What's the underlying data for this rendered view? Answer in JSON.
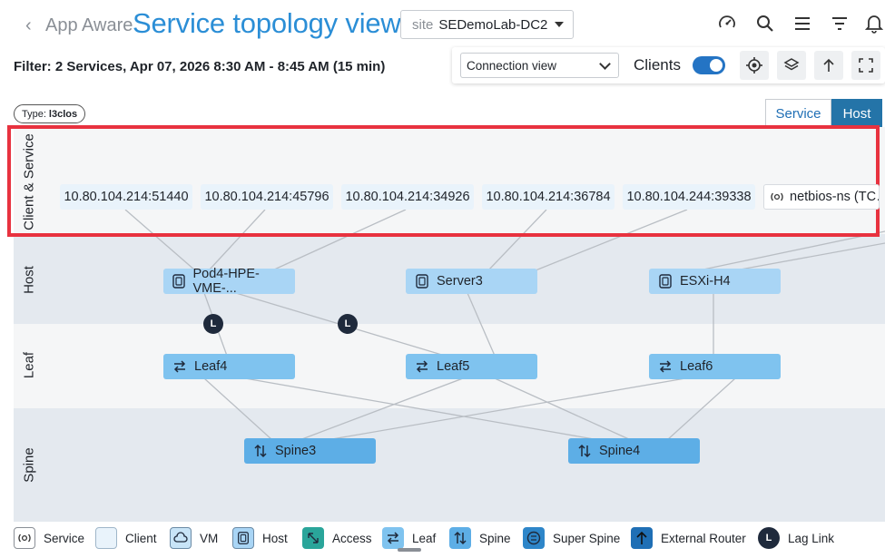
{
  "header": {
    "back_icon": "chevron-left-icon",
    "app_name": "App Aware",
    "title": "Service topology view",
    "site_label": "site",
    "site_value": "SEDemoLab-DC2",
    "icons": [
      "speedometer-icon",
      "search-icon",
      "menu-icon",
      "filter-icon",
      "bell-icon"
    ]
  },
  "filter_text": "Filter: 2 Services, Apr 07, 2026 8:30 AM - 8:45 AM (15 min)",
  "toolbar": {
    "view_select": "Connection view",
    "clients_label": "Clients",
    "clients_on": true,
    "buttons": [
      "locate-icon",
      "layers-icon",
      "arrow-up-icon",
      "fullscreen-icon"
    ]
  },
  "type_badge": {
    "label": "Type:",
    "value": "l3clos"
  },
  "segment": {
    "service": "Service",
    "host": "Host",
    "active": "Host"
  },
  "bands": {
    "client": "Client & Service",
    "host": "Host",
    "leaf": "Leaf",
    "spine": "Spine"
  },
  "nodes": {
    "clients": [
      "10.80.104.214:51440",
      "10.80.104.214:45796",
      "10.80.104.214:34926",
      "10.80.104.214:36784",
      "10.80.104.244:39338"
    ],
    "service": "netbios-ns (TC…",
    "hosts": [
      "Pod4-HPE-VME-...",
      "Server3",
      "ESXi-H4"
    ],
    "leafs": [
      "Leaf4",
      "Leaf5",
      "Leaf6"
    ],
    "spines": [
      "Spine3",
      "Spine4"
    ],
    "lag_label": "L"
  },
  "legend": [
    {
      "label": "Service",
      "icon": "service-icon"
    },
    {
      "label": "Client",
      "icon": "client-icon"
    },
    {
      "label": "VM",
      "icon": "vm-icon"
    },
    {
      "label": "Host",
      "icon": "host-icon"
    },
    {
      "label": "Access",
      "icon": "access-icon"
    },
    {
      "label": "Leaf",
      "icon": "leaf-icon"
    },
    {
      "label": "Spine",
      "icon": "spine-icon"
    },
    {
      "label": "Super Spine",
      "icon": "super-spine-icon"
    },
    {
      "label": "External Router",
      "icon": "external-router-icon"
    },
    {
      "label": "Lag Link",
      "icon": "lag-link-icon"
    }
  ],
  "colors": {
    "title_blue": "#2b8ed6",
    "highlight_red": "#e8323f",
    "host_node": "#a9d5f5",
    "leaf_node": "#7fc3ef",
    "spine_node": "#5daee6",
    "toggle_on": "#2474c4"
  }
}
